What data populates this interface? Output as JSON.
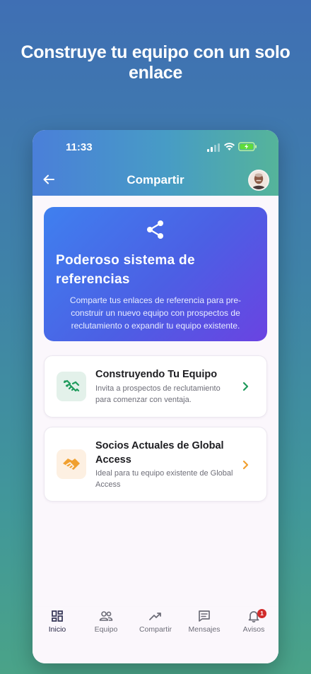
{
  "headline": "Construye tu equipo con un solo enlace",
  "status": {
    "time": "11:33"
  },
  "header": {
    "title": "Compartir",
    "back_icon": "back-arrow-icon",
    "avatar": "user-avatar"
  },
  "hero": {
    "icon": "share-icon",
    "title": "Poderoso sistema de referencias",
    "description": "Comparte tus enlaces de referencia para pre-construir un nuevo equipo con prospectos de reclutamiento o expandir tu equipo existente."
  },
  "cards": [
    {
      "icon": "handshake-outline-icon",
      "title": "Construyendo Tu Equipo",
      "description": "Invita a prospectos de reclutamiento para comenzar con ventaja.",
      "accent": "#1f9a5c"
    },
    {
      "icon": "handshake-icon",
      "title": "Socios Actuales de Global Access",
      "description": "Ideal para tu equipo existente de Global Access",
      "accent": "#f0a030"
    }
  ],
  "tabs": [
    {
      "label": "Inicio",
      "icon": "dashboard-icon",
      "active": true
    },
    {
      "label": "Equipo",
      "icon": "team-icon"
    },
    {
      "label": "Compartir",
      "icon": "trending-up-icon"
    },
    {
      "label": "Mensajes",
      "icon": "message-icon"
    },
    {
      "label": "Avisos",
      "icon": "bell-icon",
      "badge": "1"
    }
  ],
  "colors": {
    "header_start": "#4a7fd9",
    "header_end": "#55b49a",
    "hero_start": "#3f80ef",
    "hero_end": "#6a43e2",
    "badge": "#d12b2b"
  }
}
